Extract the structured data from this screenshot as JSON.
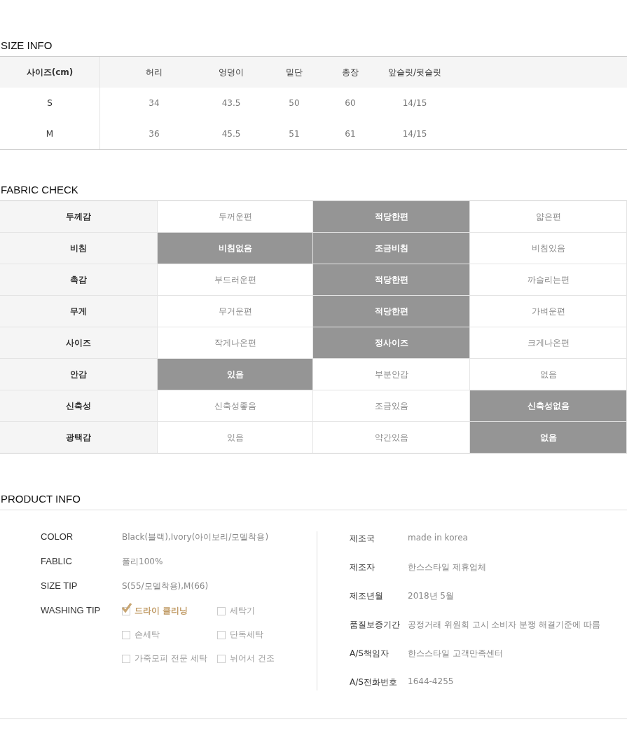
{
  "size_info": {
    "title": "SIZE INFO",
    "columns": [
      "사이즈(cm)",
      "허리",
      "엉덩이",
      "밑단",
      "총장",
      "앞슬릿/뒷슬릿"
    ],
    "rows": [
      [
        "S",
        "34",
        "43.5",
        "50",
        "60",
        "14/15"
      ],
      [
        "M",
        "36",
        "45.5",
        "51",
        "61",
        "14/15"
      ]
    ]
  },
  "fabric_check": {
    "title": "FABRIC CHECK",
    "rows": [
      {
        "label": "두께감",
        "options": [
          {
            "label": "두꺼운편",
            "selected": false
          },
          {
            "label": "적당한편",
            "selected": true
          },
          {
            "label": "얇은편",
            "selected": false
          }
        ]
      },
      {
        "label": "비침",
        "options": [
          {
            "label": "비침없음",
            "selected": true
          },
          {
            "label": "조금비침",
            "selected": true
          },
          {
            "label": "비침있음",
            "selected": false
          }
        ]
      },
      {
        "label": "촉감",
        "options": [
          {
            "label": "부드러운편",
            "selected": false
          },
          {
            "label": "적당한편",
            "selected": true
          },
          {
            "label": "까슬리는편",
            "selected": false
          }
        ]
      },
      {
        "label": "무게",
        "options": [
          {
            "label": "무거운편",
            "selected": false
          },
          {
            "label": "적당한편",
            "selected": true
          },
          {
            "label": "가벼운편",
            "selected": false
          }
        ]
      },
      {
        "label": "사이즈",
        "options": [
          {
            "label": "작게나온편",
            "selected": false
          },
          {
            "label": "정사이즈",
            "selected": true
          },
          {
            "label": "크게나온편",
            "selected": false
          }
        ]
      },
      {
        "label": "안감",
        "options": [
          {
            "label": "있음",
            "selected": true
          },
          {
            "label": "부분안감",
            "selected": false
          },
          {
            "label": "없음",
            "selected": false
          }
        ]
      },
      {
        "label": "신축성",
        "options": [
          {
            "label": "신축성좋음",
            "selected": false
          },
          {
            "label": "조금있음",
            "selected": false
          },
          {
            "label": "신축성없음",
            "selected": true
          }
        ]
      },
      {
        "label": "광택감",
        "options": [
          {
            "label": "있음",
            "selected": false
          },
          {
            "label": "약간있음",
            "selected": false
          },
          {
            "label": "없음",
            "selected": true
          }
        ]
      }
    ]
  },
  "product_info": {
    "title": "PRODUCT INFO",
    "details": [
      {
        "label": "COLOR",
        "value": "Black(블랙),Ivory(아이보리/모델착용)"
      },
      {
        "label": "FABLIC",
        "value": "폴리100%"
      },
      {
        "label": "SIZE TIP",
        "value": "S(55/모델착용),M(66)"
      }
    ],
    "washing_tip": {
      "label": "WASHING TIP",
      "options": [
        {
          "label": "드라이 클리닝",
          "checked": true
        },
        {
          "label": "세탁기",
          "checked": false
        },
        {
          "label": "손세탁",
          "checked": false
        },
        {
          "label": "단독세탁",
          "checked": false
        },
        {
          "label": "가죽모피 전문 세탁",
          "checked": false
        },
        {
          "label": "뉘어서 건조",
          "checked": false
        }
      ]
    },
    "maker": [
      {
        "label": "제조국",
        "value": "made in korea"
      },
      {
        "label": "제조자",
        "value": "한스스타일 제휴업체"
      },
      {
        "label": "제조년월",
        "value": "2018년 5월"
      },
      {
        "label": "품질보증기간",
        "value": "공정거래 위원회 고시 소비자 분쟁 해결기준에 따름"
      },
      {
        "label": "A/S책임자",
        "value": "한스스타일 고객만족센터"
      },
      {
        "label": "A/S전화번호",
        "value": "1644-4255"
      }
    ]
  }
}
